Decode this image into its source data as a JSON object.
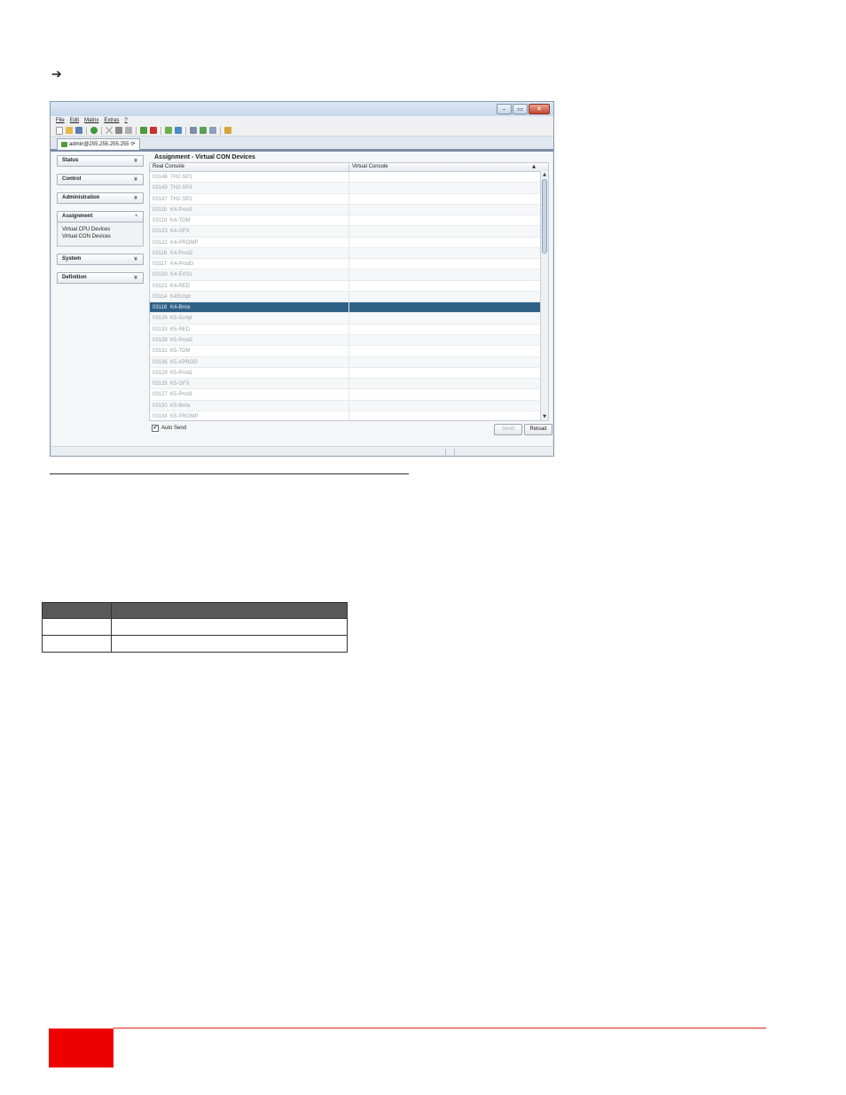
{
  "page": {
    "arrow_glyph": "➔"
  },
  "window": {
    "controls": [
      "–",
      "▭",
      "✕"
    ],
    "menu": [
      "File",
      "Edit",
      "Matrix",
      "Extras",
      "?"
    ],
    "toolbar_icons": [
      "new-file-icon",
      "open-folder-icon",
      "save-icon",
      "refresh-icon",
      "delete-icon",
      "copy-icon",
      "paste-icon",
      "connect-icon",
      "disconnect-icon",
      "upload-icon",
      "download-icon",
      "document-icon",
      "document-export-icon",
      "document-view-icon",
      "folder-config-icon"
    ],
    "tab_label": "admin@255.255.255.255",
    "tab_icon": "⟳"
  },
  "sidebar": {
    "sections": [
      {
        "label": "Status",
        "chevron": "¥"
      },
      {
        "label": "Control",
        "chevron": "¥"
      },
      {
        "label": "Administration",
        "chevron": "¥"
      },
      {
        "label": "Assignment",
        "chevron": "ᴬ",
        "items": [
          "Virtual CPU Devices",
          "Virtual CON Devices"
        ]
      },
      {
        "label": "System",
        "chevron": "¥"
      },
      {
        "label": "Definition",
        "chevron": "¥"
      }
    ]
  },
  "main": {
    "title": "Assignment - Virtual CON Devices",
    "columns": [
      "Real Console",
      "Virtual Console"
    ],
    "sort_indicator": "▲",
    "rows": [
      {
        "id": "03148",
        "name": "TH2-SP1"
      },
      {
        "id": "03149",
        "name": "TH2-SP3"
      },
      {
        "id": "03147",
        "name": "TH2-SP2"
      },
      {
        "id": "03115",
        "name": "K4-Prod1"
      },
      {
        "id": "03119",
        "name": "K4-TOM"
      },
      {
        "id": "03123",
        "name": "K4-GFX"
      },
      {
        "id": "03122",
        "name": "K4-PROMP"
      },
      {
        "id": "03116",
        "name": "K4-Prod2"
      },
      {
        "id": "03117",
        "name": "K4-ProdD"
      },
      {
        "id": "03120",
        "name": "K4-EVS1"
      },
      {
        "id": "03121",
        "name": "K4-RED"
      },
      {
        "id": "03114",
        "name": "K4Script"
      },
      {
        "id": "03118",
        "name": "K4-Bmix",
        "selected": true
      },
      {
        "id": "03126",
        "name": "K5-Script"
      },
      {
        "id": "03133",
        "name": "K5-RED"
      },
      {
        "id": "03128",
        "name": "K5-Prod2"
      },
      {
        "id": "03131",
        "name": "K5-TOM"
      },
      {
        "id": "03136",
        "name": "K5-XPROD"
      },
      {
        "id": "03129",
        "name": "K5-Prod1"
      },
      {
        "id": "03135",
        "name": "K5-GFX"
      },
      {
        "id": "03127",
        "name": "K5-Prod1"
      },
      {
        "id": "03130",
        "name": "K5-Bmix"
      },
      {
        "id": "03134",
        "name": "K5-PROMP"
      }
    ],
    "auto_send_label": "Auto Send",
    "auto_send_checked": "✔",
    "send_label": "Send",
    "reload_label": "Reload",
    "scroll_up": "▲",
    "scroll_down": "▼"
  },
  "colors": {
    "selected_row": "#2f6187",
    "footer_red": "#ee0000",
    "table_header": "#595959"
  }
}
